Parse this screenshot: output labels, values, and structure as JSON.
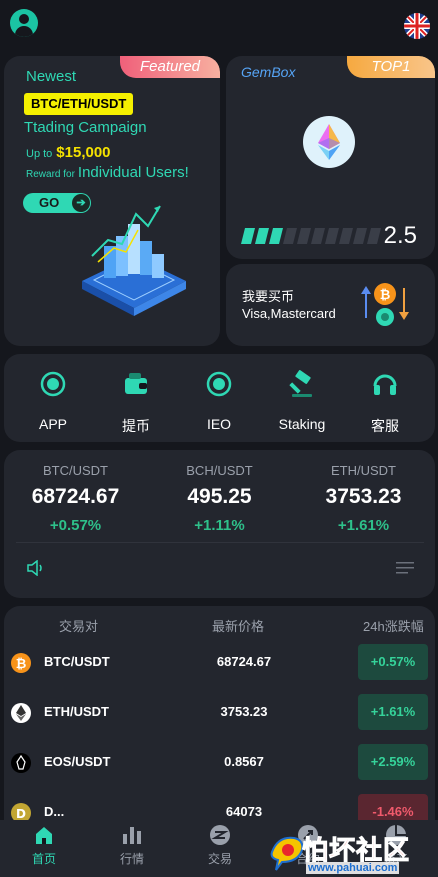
{
  "header": {
    "avatar_icon": "user-avatar-icon",
    "flag_icon": "uk-flag-icon"
  },
  "featured": {
    "tag": "Featured",
    "newest": "Newest",
    "pair_badge": "BTC/ETH/USDT",
    "campaign": "Ttading Campaign",
    "upto_label": "Up to",
    "upto_amount": "$15,000",
    "reward_label": "Reward for",
    "reward_target": "Individual Users!",
    "go_label": "GO"
  },
  "gembox": {
    "title": "GemBox",
    "tag": "TOP1",
    "level": "2.5",
    "progress_segments_filled": 3,
    "progress_segments_total": 10
  },
  "buy": {
    "line1": "我要买币",
    "line2": "Visa,Mastercard"
  },
  "menu": [
    {
      "label": "APP",
      "icon": "app-icon"
    },
    {
      "label": "提币",
      "icon": "wallet-icon"
    },
    {
      "label": "IEO",
      "icon": "ieo-icon"
    },
    {
      "label": "Staking",
      "icon": "hammer-icon"
    },
    {
      "label": "客服",
      "icon": "headset-icon"
    }
  ],
  "tickers": [
    {
      "pair": "BTC/USDT",
      "price": "68724.67",
      "change": "+0.57%"
    },
    {
      "pair": "BCH/USDT",
      "price": "495.25",
      "change": "+1.11%"
    },
    {
      "pair": "ETH/USDT",
      "price": "3753.23",
      "change": "+1.61%"
    }
  ],
  "market": {
    "headers": {
      "pair": "交易对",
      "price": "最新价格",
      "change": "24h涨跌幅"
    },
    "rows": [
      {
        "pair": "BTC/USDT",
        "price": "68724.67",
        "change": "+0.57%",
        "dir": "up",
        "icon": "bitcoin-icon",
        "color": "#f7931a"
      },
      {
        "pair": "ETH/USDT",
        "price": "3753.23",
        "change": "+1.61%",
        "dir": "up",
        "icon": "ethereum-icon",
        "color": "#ffffff"
      },
      {
        "pair": "EOS/USDT",
        "price": "0.8567",
        "change": "+2.59%",
        "dir": "up",
        "icon": "eos-icon",
        "color": "#000000"
      },
      {
        "pair": "D...",
        "price": "64073",
        "change": "-1.46%",
        "dir": "down",
        "icon": "doge-icon",
        "color": "#c2a633"
      }
    ]
  },
  "nav": [
    {
      "label": "首页",
      "icon": "home-icon",
      "active": true
    },
    {
      "label": "行情",
      "icon": "chart-bars-icon",
      "active": false
    },
    {
      "label": "交易",
      "icon": "trade-icon",
      "active": false
    },
    {
      "label": "合约",
      "icon": "contract-icon",
      "active": false
    },
    {
      "label": "资产",
      "icon": "assets-icon",
      "active": false
    }
  ],
  "watermark": {
    "text": "怕坏社区",
    "url": "www.pahuai.com"
  },
  "colors": {
    "accent": "#2fd8b4",
    "up": "#35d39a",
    "down": "#f05a6c",
    "card": "#23262e",
    "bg": "#15171d"
  }
}
